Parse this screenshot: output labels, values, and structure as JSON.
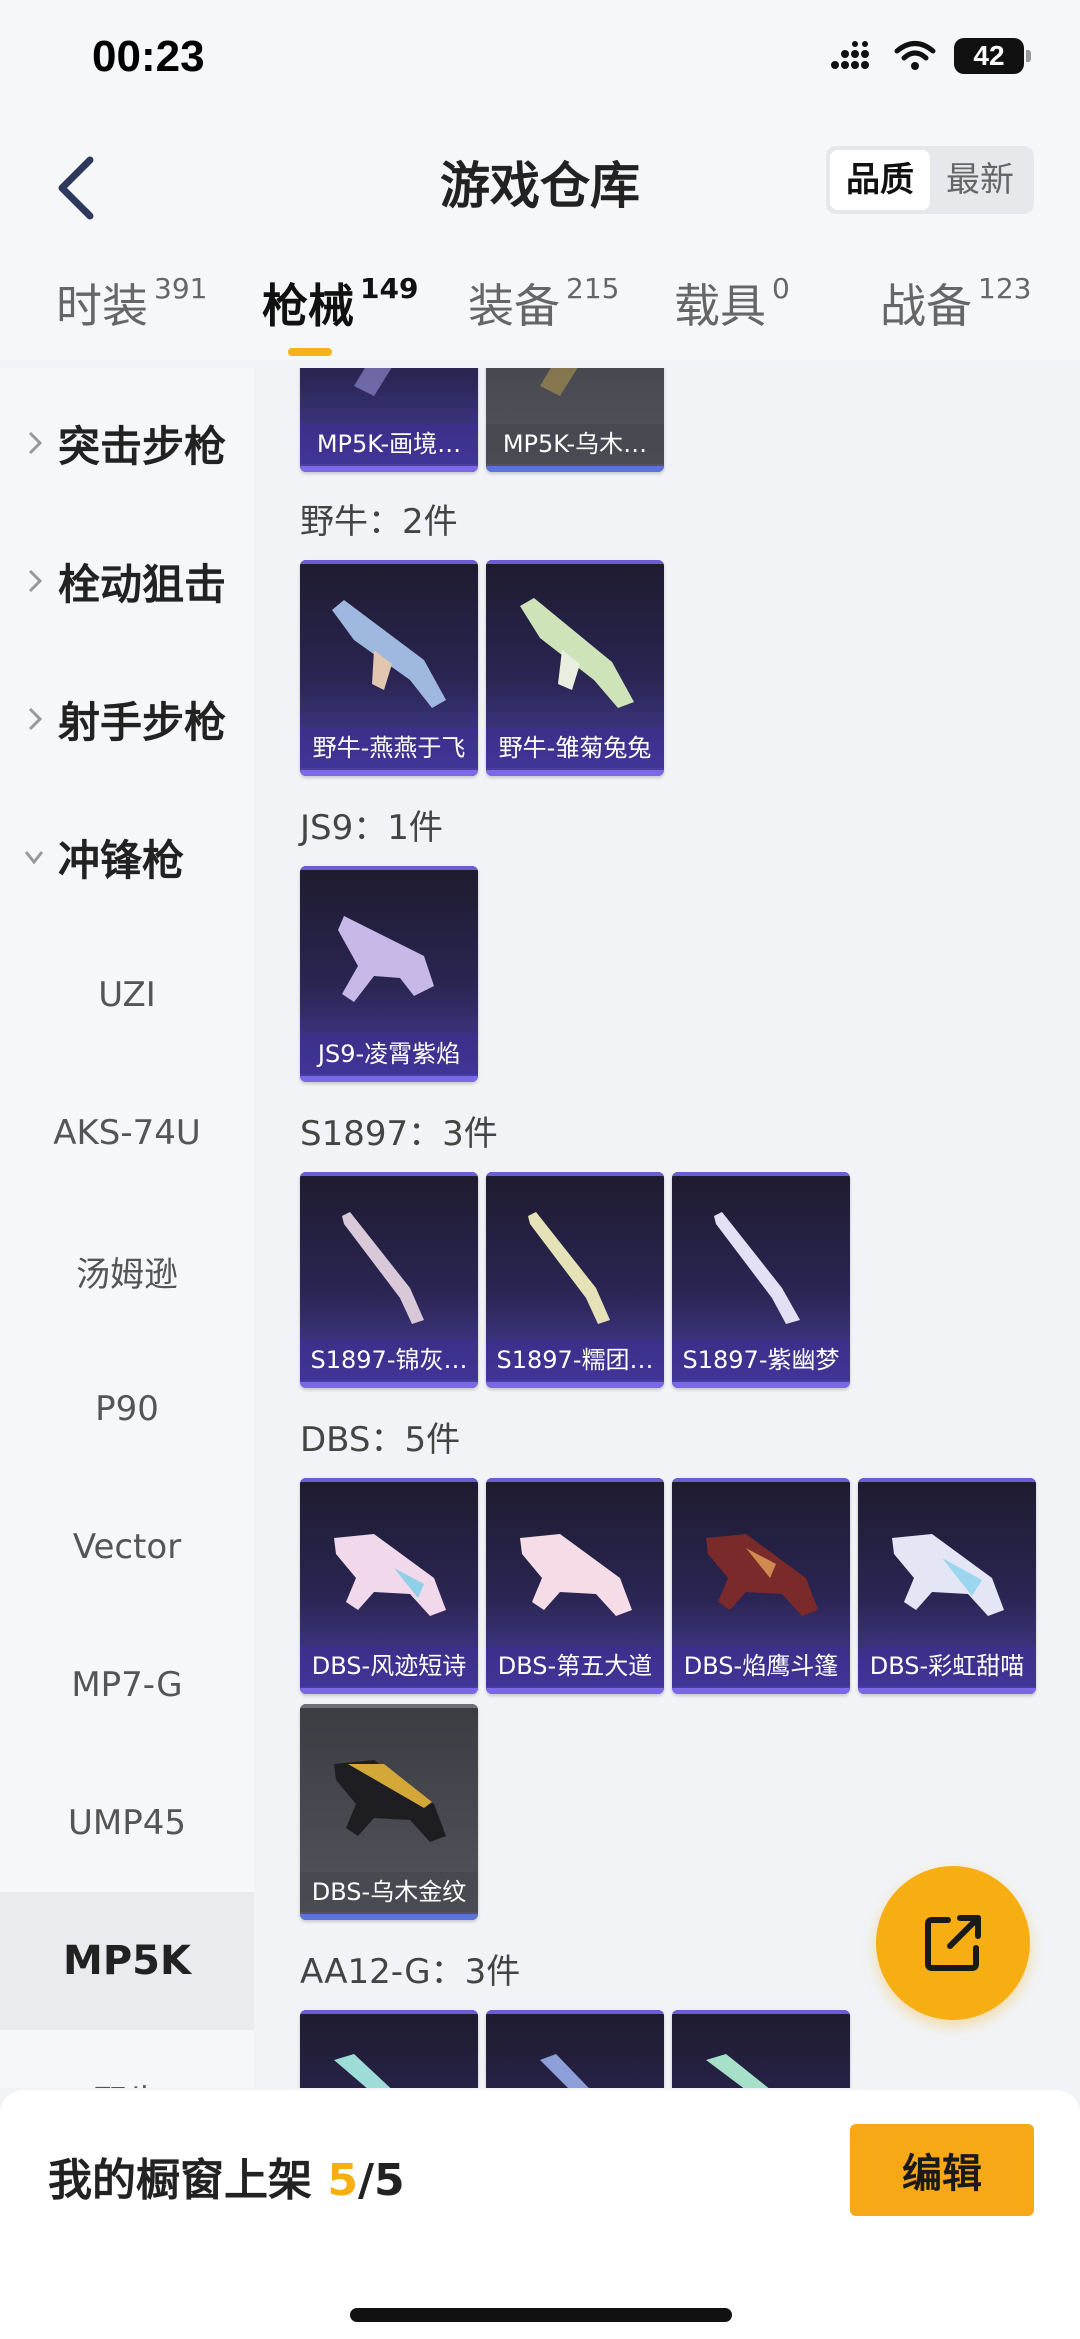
{
  "status_bar": {
    "time": "00:23",
    "battery": "42"
  },
  "header": {
    "title": "游戏仓库",
    "sort_options": [
      "品质",
      "最新"
    ],
    "sort_selected": "品质"
  },
  "tabs": [
    {
      "label": "时装",
      "count": "391"
    },
    {
      "label": "枪械",
      "count": "149",
      "active": true
    },
    {
      "label": "装备",
      "count": "215"
    },
    {
      "label": "载具",
      "count": "0"
    },
    {
      "label": "战备",
      "count": "123"
    }
  ],
  "sidebar": {
    "categories": [
      "突击步枪",
      "栓动狙击",
      "射手步枪",
      "冲锋枪"
    ],
    "sub_items": [
      "UZI",
      "AKS-74U",
      "汤姆逊",
      "P90",
      "Vector",
      "MP7-G",
      "UMP45",
      "MP5K",
      "野牛"
    ],
    "selected": "MP5K"
  },
  "content": {
    "mp5k_items": [
      "MP5K-画境…",
      "MP5K-乌木…"
    ],
    "groups": [
      {
        "label": "野牛：2件",
        "items": [
          "野牛-燕燕于飞",
          "野牛-雏菊兔兔"
        ]
      },
      {
        "label": "JS9：1件",
        "items": [
          "JS9-凌霄紫焰"
        ]
      },
      {
        "label": "S1897：3件",
        "items": [
          "S1897-锦灰…",
          "S1897-糯团…",
          "S1897-紫幽梦"
        ]
      },
      {
        "label": "DBS：5件",
        "items": [
          "DBS-风迹短诗",
          "DBS-第五大道",
          "DBS-焰鹰斗篷",
          "DBS-彩虹甜喵",
          "DBS-乌木金纹"
        ]
      },
      {
        "label": "AA12-G：3件",
        "items": []
      }
    ]
  },
  "bottom_bar": {
    "showcase_label": "我的橱窗上架",
    "showcase_count": "5",
    "showcase_total": "/5",
    "edit_label": "编辑"
  },
  "colors": {
    "accent": "#f6ae12",
    "card_purple": "#4b3fa2",
    "card_gray": "#4a4b52"
  }
}
